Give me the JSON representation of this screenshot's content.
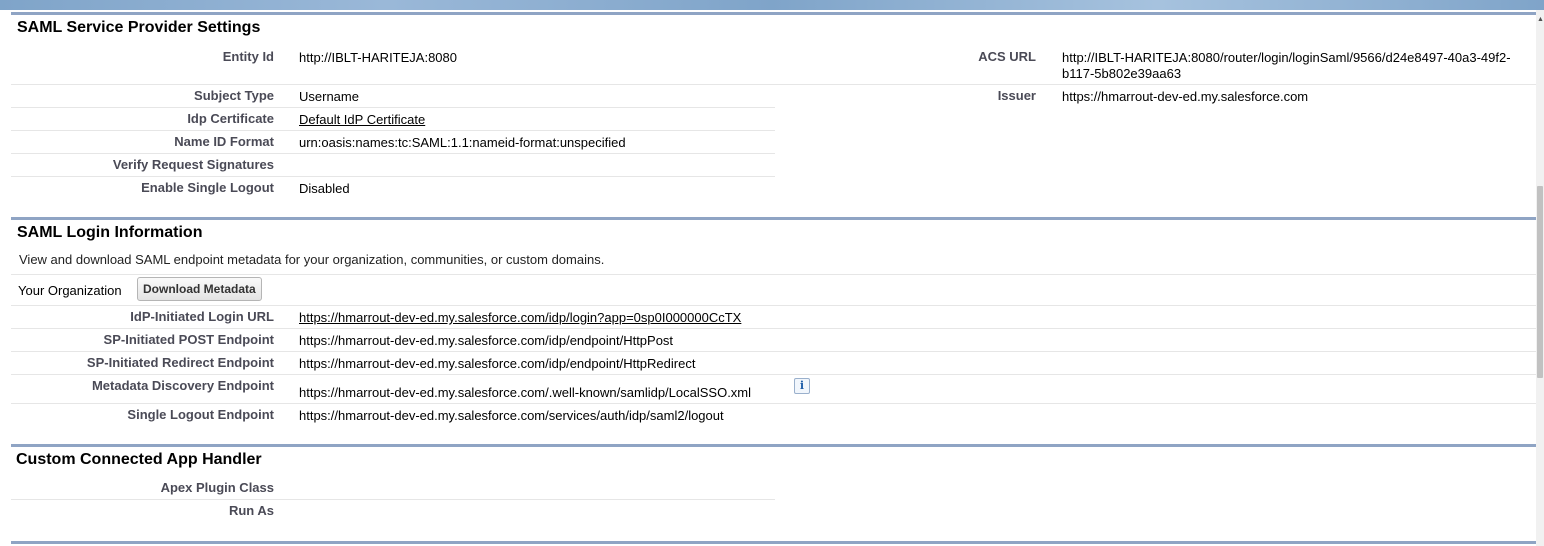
{
  "sp_settings": {
    "title": "SAML Service Provider Settings",
    "entity_id": {
      "label": "Entity Id",
      "value": "http://IBLT-HARITEJA:8080"
    },
    "acs_url": {
      "label": "ACS URL",
      "value": "http://IBLT-HARITEJA:8080/router/login/loginSaml/9566/d24e8497-40a3-49f2-b117-5b802e39aa63"
    },
    "subject_type": {
      "label": "Subject Type",
      "value": "Username"
    },
    "issuer": {
      "label": "Issuer",
      "value": "https://hmarrout-dev-ed.my.salesforce.com"
    },
    "idp_certificate": {
      "label": "Idp Certificate",
      "value": "Default IdP Certificate"
    },
    "name_id_format": {
      "label": "Name ID Format",
      "value": "urn:oasis:names:tc:SAML:1.1:nameid-format:unspecified"
    },
    "verify_request_signatures": {
      "label": "Verify Request Signatures",
      "value": ""
    },
    "enable_single_logout": {
      "label": "Enable Single Logout",
      "value": "Disabled"
    }
  },
  "login_info": {
    "title": "SAML Login Information",
    "description": "View and download SAML endpoint metadata for your organization, communities, or custom domains.",
    "your_org_label": "Your Organization",
    "download_button": "Download Metadata",
    "idp_login_url": {
      "label": "IdP-Initiated Login URL",
      "value": "https://hmarrout-dev-ed.my.salesforce.com/idp/login?app=0sp0I000000CcTX"
    },
    "sp_post": {
      "label": "SP-Initiated POST Endpoint",
      "value": "https://hmarrout-dev-ed.my.salesforce.com/idp/endpoint/HttpPost"
    },
    "sp_redirect": {
      "label": "SP-Initiated Redirect Endpoint",
      "value": "https://hmarrout-dev-ed.my.salesforce.com/idp/endpoint/HttpRedirect"
    },
    "metadata_discovery": {
      "label": "Metadata Discovery Endpoint",
      "value": "https://hmarrout-dev-ed.my.salesforce.com/.well-known/samlidp/LocalSSO.xml",
      "info_icon": "info-icon"
    },
    "single_logout": {
      "label": "Single Logout Endpoint",
      "value": "https://hmarrout-dev-ed.my.salesforce.com/services/auth/idp/saml2/logout"
    }
  },
  "handler": {
    "title": "Custom Connected App Handler",
    "apex_plugin_class": {
      "label": "Apex Plugin Class",
      "value": ""
    },
    "run_as": {
      "label": "Run As",
      "value": ""
    }
  },
  "colors": {
    "section_border": "#8fa4c4",
    "label": "#4a4a56",
    "header_band": "#7fa4c9"
  }
}
